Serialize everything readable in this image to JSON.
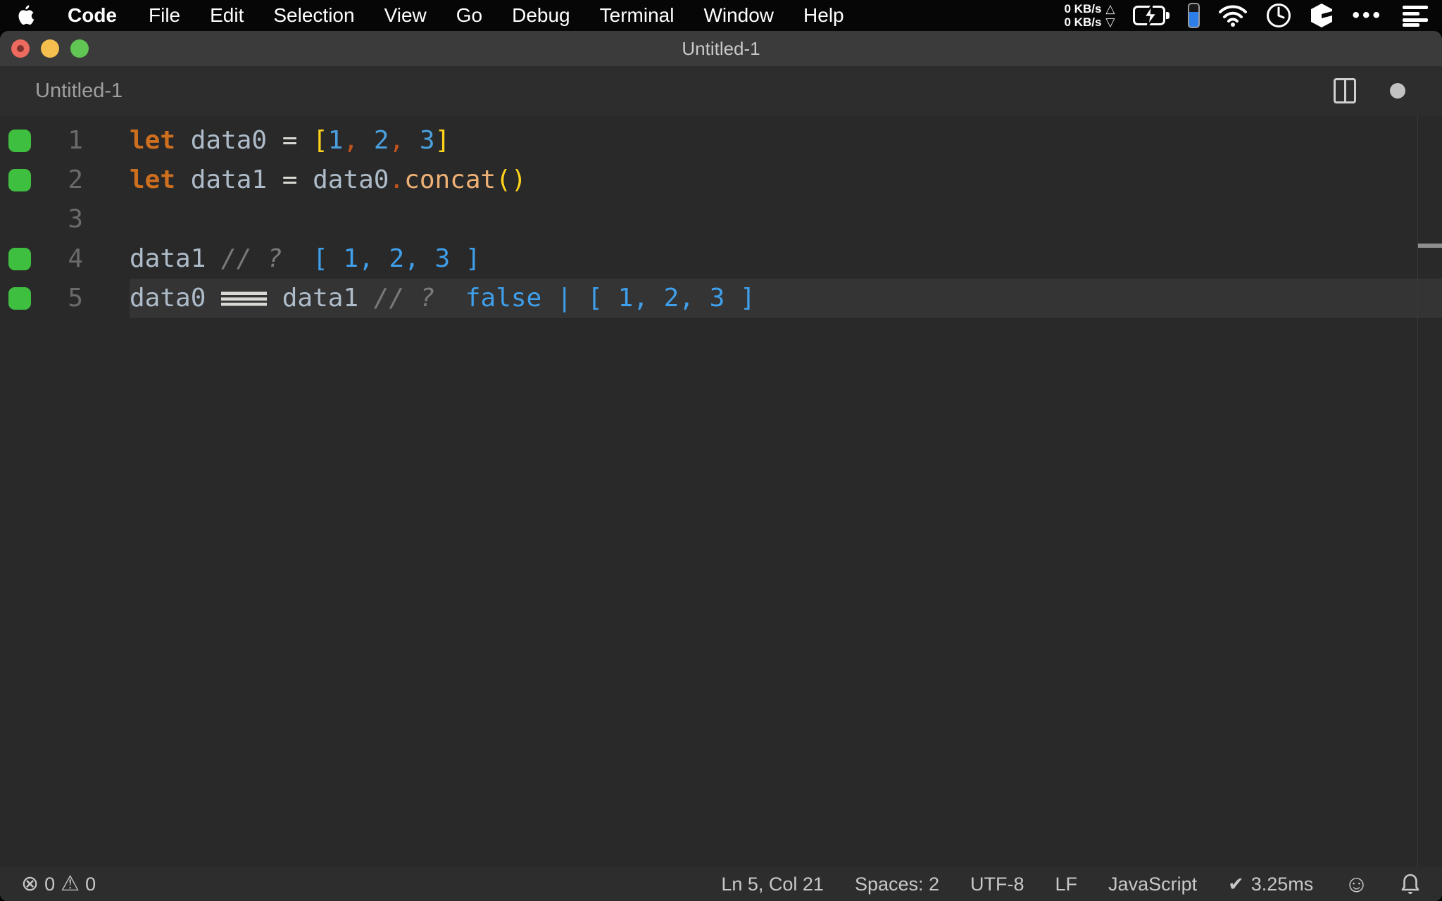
{
  "menu_bar": {
    "app_menu": "Code",
    "items": [
      "File",
      "Edit",
      "Selection",
      "View",
      "Go",
      "Debug",
      "Terminal",
      "Window",
      "Help"
    ],
    "network": {
      "up_value": "0 KB/s",
      "down_value": "0 KB/s",
      "up_arrow": "△",
      "down_arrow": "▽"
    },
    "ellipsis": "•••"
  },
  "titlebar": {
    "title": "Untitled-1"
  },
  "tabbar": {
    "title": "Untitled-1"
  },
  "editor": {
    "lines": [
      {
        "number": "1",
        "covered": true,
        "current": false,
        "tokens": [
          {
            "c": "kw",
            "t": "let "
          },
          {
            "c": "id",
            "t": "data0"
          },
          {
            "c": "op",
            "t": " = "
          },
          {
            "c": "br",
            "t": "["
          },
          {
            "c": "num",
            "t": "1"
          },
          {
            "c": "pun",
            "t": ", "
          },
          {
            "c": "num",
            "t": "2"
          },
          {
            "c": "pun",
            "t": ", "
          },
          {
            "c": "num",
            "t": "3"
          },
          {
            "c": "br",
            "t": "]"
          }
        ]
      },
      {
        "number": "2",
        "covered": true,
        "current": false,
        "tokens": [
          {
            "c": "kw",
            "t": "let "
          },
          {
            "c": "id",
            "t": "data1"
          },
          {
            "c": "op",
            "t": " = "
          },
          {
            "c": "id",
            "t": "data0"
          },
          {
            "c": "pun",
            "t": "."
          },
          {
            "c": "fn",
            "t": "concat"
          },
          {
            "c": "br",
            "t": "()"
          }
        ]
      },
      {
        "number": "3",
        "covered": false,
        "current": false,
        "tokens": []
      },
      {
        "number": "4",
        "covered": true,
        "current": false,
        "tokens": [
          {
            "c": "id",
            "t": "data1"
          },
          {
            "c": "cm",
            "t": " // ?"
          },
          {
            "c": "res",
            "t": "  [ 1, 2, 3 ]"
          }
        ]
      },
      {
        "number": "5",
        "covered": true,
        "current": true,
        "tokens": [
          {
            "c": "id",
            "t": "data0 "
          },
          {
            "c": "eq3",
            "t": "==="
          },
          {
            "c": "id",
            "t": " data1"
          },
          {
            "c": "cm",
            "t": " // ?"
          },
          {
            "c": "res",
            "t": "  false | [ 1, 2, 3 ]"
          }
        ]
      }
    ]
  },
  "status_bar": {
    "error_icon": "⊗",
    "error_count": "0",
    "warning_icon": "⚠",
    "warning_count": "0",
    "cursor_position": "Ln 5, Col 21",
    "indentation": "Spaces: 2",
    "encoding": "UTF-8",
    "eol": "LF",
    "language": "JavaScript",
    "quokka_check": "✔",
    "quokka_time": "3.25ms",
    "feedback_icon": "☺"
  },
  "colors": {
    "keyword": "#ce6f1f",
    "identifier": "#aebcca",
    "operator": "#d9d9d3",
    "bracket": "#ffd319",
    "number": "#4aa0dd",
    "punctuation": "#c2541b",
    "function": "#efb175",
    "comment": "#7a7a7a",
    "quokka_result": "#3f9fea",
    "coverage_green": "#3fbf3f",
    "editor_bg": "#292929",
    "current_line_bg": "#343434",
    "menubar_bg": "#060606",
    "titlebar_bg": "#3b3b3b",
    "tabbar_bg": "#2d2d2d",
    "statusbar_bg": "#2d2d2d"
  }
}
